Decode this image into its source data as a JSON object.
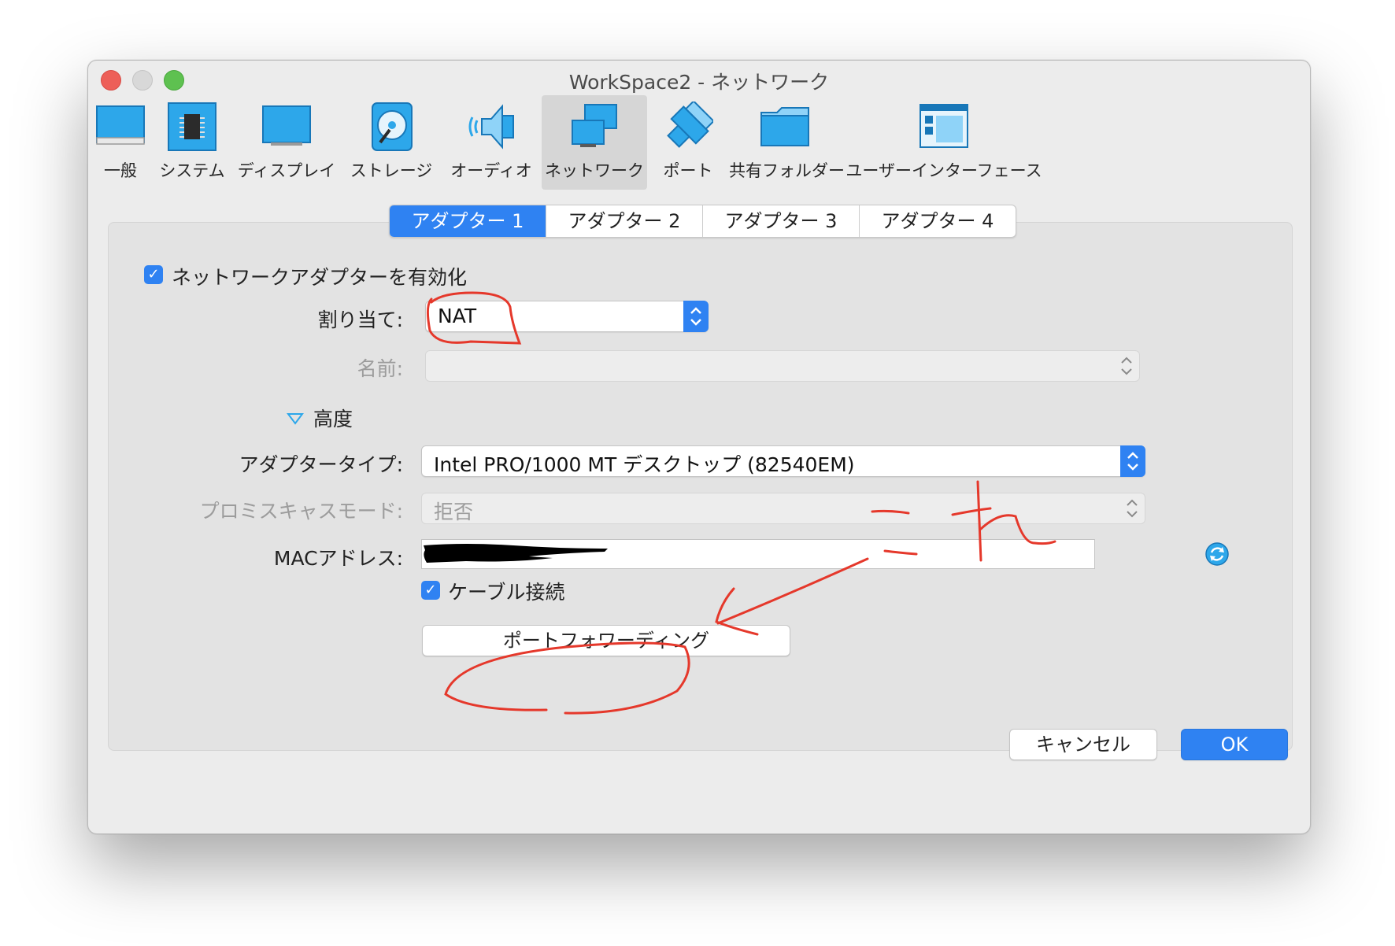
{
  "window": {
    "title": "WorkSpace2 - ネットワーク"
  },
  "toolbar": {
    "items": [
      {
        "label": "一般",
        "icon": "general-icon"
      },
      {
        "label": "システム",
        "icon": "system-chip-icon"
      },
      {
        "label": "ディスプレイ",
        "icon": "display-icon"
      },
      {
        "label": "ストレージ",
        "icon": "storage-disk-icon"
      },
      {
        "label": "オーディオ",
        "icon": "audio-speaker-icon"
      },
      {
        "label": "ネットワーク",
        "icon": "network-icon",
        "active": true
      },
      {
        "label": "ポート",
        "icon": "port-icon"
      },
      {
        "label": "共有フォルダー",
        "icon": "folder-icon"
      },
      {
        "label": "ユーザーインターフェース",
        "icon": "user-interface-icon"
      }
    ]
  },
  "tabs": [
    {
      "label": "アダプター 1",
      "active": true
    },
    {
      "label": "アダプター 2"
    },
    {
      "label": "アダプター 3"
    },
    {
      "label": "アダプター 4"
    }
  ],
  "form": {
    "enable_adapter": {
      "label": "ネットワークアダプターを有効化",
      "checked": true
    },
    "attached_to": {
      "label": "割り当て:",
      "value": "NAT"
    },
    "name": {
      "label": "名前:",
      "value": ""
    },
    "advanced": {
      "label": "高度",
      "expanded": true
    },
    "adapter_type": {
      "label": "アダプタータイプ:",
      "value": "Intel PRO/1000 MT デスクトップ (82540EM)"
    },
    "promiscuous": {
      "label": "プロミスキャスモード:",
      "value": "拒否"
    },
    "mac": {
      "label": "MACアドレス:",
      "value": ""
    },
    "cable": {
      "label": "ケーブル接続",
      "checked": true
    },
    "port_forwarding": {
      "label": "ポートフォワーディング"
    }
  },
  "footer": {
    "cancel_label": "キャンセル",
    "ok_label": "OK"
  },
  "annotation": {
    "text": "これ",
    "color": "#e5382b"
  },
  "colors": {
    "accent": "#2f82f2",
    "icon_blue": "#2da7ea",
    "window_bg": "#ececec"
  }
}
